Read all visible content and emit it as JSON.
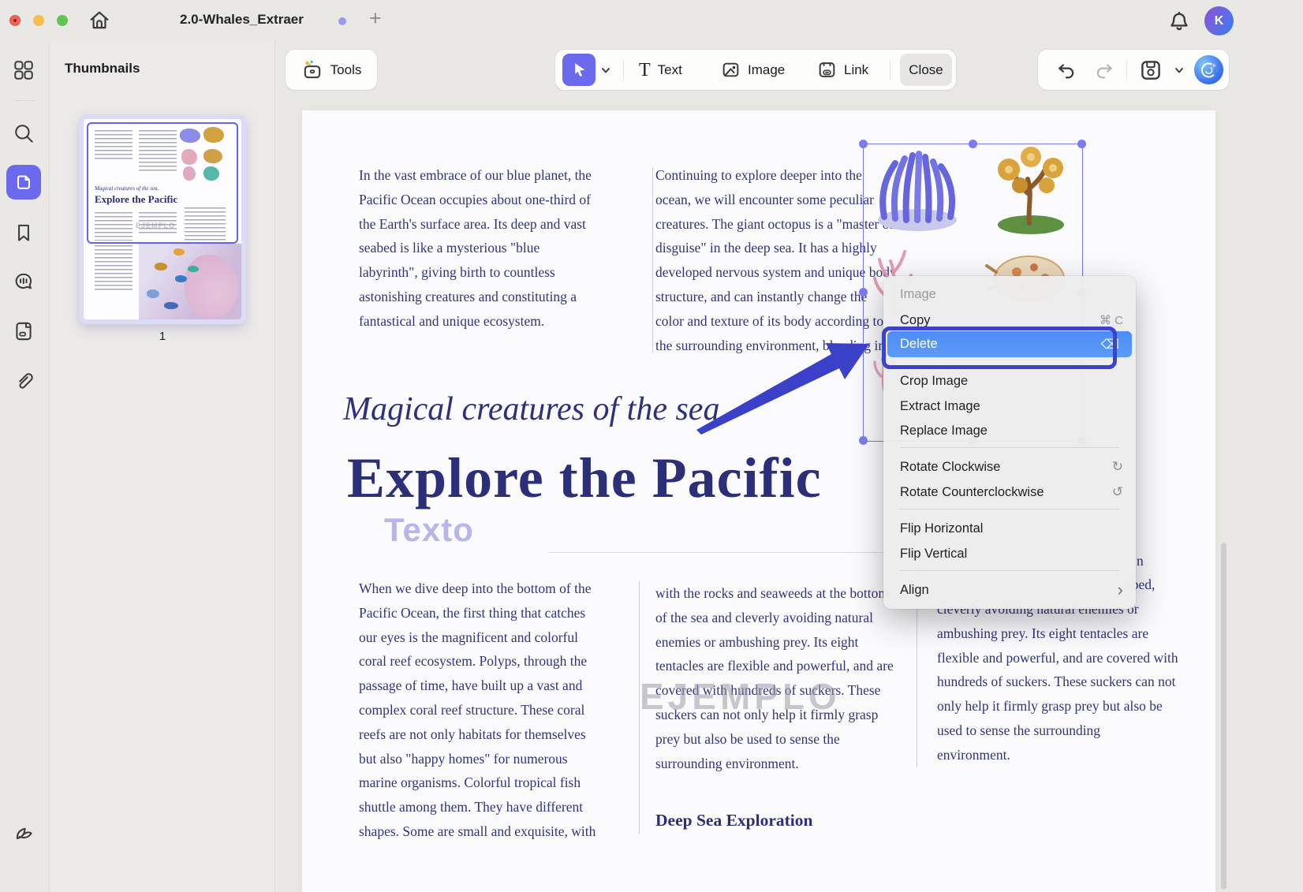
{
  "titlebar": {
    "tab_title": "2.0-Whales_Extraer",
    "new_tab": "+"
  },
  "account": {
    "initial": "K"
  },
  "toolbar": {
    "tools": "Tools",
    "text": "Text",
    "image": "Image",
    "link": "Link",
    "close": "Close"
  },
  "panels": {
    "thumbnails_header": "Thumbnails",
    "page_number": "1"
  },
  "thumb_mini": {
    "subtitle": "Magical creatures of the sea.",
    "title": "Explore the Pacific",
    "watermark": "EJEMPLO"
  },
  "doc": {
    "para_top_left": "In the vast embrace of our blue planet, the\nPacific Ocean occupies about one-third of\nthe Earth's surface area. Its deep and vast\nseabed is like a mysterious \"blue\nlabyrinth\", giving birth to countless\nastonishing creatures and constituting a\nfantastical and unique ecosystem.",
    "para_top_mid": "Continuing to explore deeper into the\nocean, we will encounter some peculiar\ncreatures. The giant octopus is a \"master of\ndisguise\" in the deep sea. It has a highly\ndeveloped nervous system and unique body\nstructure, and can instantly change the\ncolor and texture of its body according to\nthe surrounding environment, blending in",
    "subtitle": "Magical creatures of the sea.",
    "title": "Explore the Pacific",
    "texto": "Texto",
    "para_bottom_left": "When we dive deep into the bottom of the\nPacific Ocean, the first thing that catches\nour eyes is the magnificent and colorful\ncoral reef ecosystem. Polyps, through the\npassage of time, have built up a vast and\ncomplex coral reef structure. These coral\nreefs are not only habitats for themselves\nbut also \"happy homes\" for numerous\nmarine organisms. Colorful tropical fish\nshuttle among them. They have different\nshapes. Some are small and exquisite, with",
    "para_bottom_mid": "with the rocks and seaweeds at the bottom\nof the sea and cleverly avoiding natural\nenemies or ambushing prey. Its eight\ntentacles are flexible and powerful, and are\ncovered with hundreds of suckers. These\nsuckers can not only help it firmly grasp\nprey but also be used to sense the\nsurrounding environment.",
    "frag_right_1": "n",
    "frag_right_2": "abed,",
    "para_bottom_right": "cleverly avoiding natural enemies or\nambushing prey. Its eight tentacles are\nflexible and powerful, and are covered with\nhundreds of suckers. These suckers can not\nonly help it firmly grasp prey but also be\nused to sense the surrounding\nenvironment.",
    "watermark": "EJEMPLO",
    "section_heading": "Deep Sea Exploration"
  },
  "context_menu": {
    "header": "Image",
    "items": [
      {
        "label": "Copy",
        "shortcut": "⌘ C"
      },
      {
        "label": "Delete",
        "shortcut": "⌫"
      },
      {
        "label": "Crop Image"
      },
      {
        "label": "Extract Image"
      },
      {
        "label": "Replace Image"
      },
      {
        "label": "Rotate Clockwise",
        "icon": "↻"
      },
      {
        "label": "Rotate Counterclockwise",
        "icon": "↺"
      },
      {
        "label": "Flip Horizontal"
      },
      {
        "label": "Flip Vertical"
      },
      {
        "label": "Align",
        "chevron": "›"
      }
    ]
  },
  "colors": {
    "accent": "#6b6aee",
    "annotation": "#3c43c6",
    "delete_highlight": "#5596f6",
    "navy": "#31347c"
  }
}
